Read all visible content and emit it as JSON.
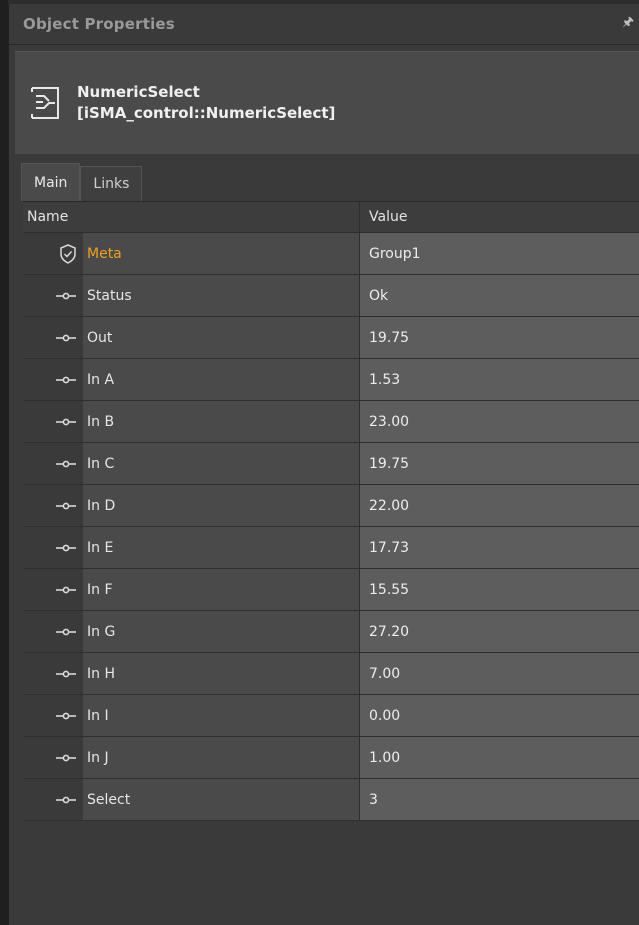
{
  "panel": {
    "title": "Object Properties",
    "pin_icon": "pin-icon"
  },
  "object": {
    "name": "NumericSelect",
    "type": "[iSMA_control::NumericSelect]",
    "icon": "numeric-select-icon"
  },
  "tabs": [
    {
      "label": "Main",
      "active": true
    },
    {
      "label": "Links",
      "active": false
    }
  ],
  "grid": {
    "headers": {
      "name": "Name",
      "value": "Value"
    },
    "rows": [
      {
        "name": "Meta",
        "value": "Group1",
        "icon": "shield-icon"
      },
      {
        "name": "Status",
        "value": "Ok",
        "icon": "slot-icon"
      },
      {
        "name": "Out",
        "value": "19.75",
        "icon": "slot-icon"
      },
      {
        "name": "In A",
        "value": "1.53",
        "icon": "slot-icon"
      },
      {
        "name": "In B",
        "value": "23.00",
        "icon": "slot-icon"
      },
      {
        "name": "In C",
        "value": "19.75",
        "icon": "slot-icon"
      },
      {
        "name": "In D",
        "value": "22.00",
        "icon": "slot-icon"
      },
      {
        "name": "In E",
        "value": "17.73",
        "icon": "slot-icon"
      },
      {
        "name": "In F",
        "value": "15.55",
        "icon": "slot-icon"
      },
      {
        "name": "In G",
        "value": "27.20",
        "icon": "slot-icon"
      },
      {
        "name": "In H",
        "value": "7.00",
        "icon": "slot-icon"
      },
      {
        "name": "In I",
        "value": "0.00",
        "icon": "slot-icon"
      },
      {
        "name": "In J",
        "value": "1.00",
        "icon": "slot-icon"
      },
      {
        "name": "Select",
        "value": "3",
        "icon": "slot-icon"
      }
    ]
  },
  "colors": {
    "meta_label": "#f0a020",
    "panel_bg": "#3a3a3a",
    "value_bg": "#5d5d5d"
  }
}
